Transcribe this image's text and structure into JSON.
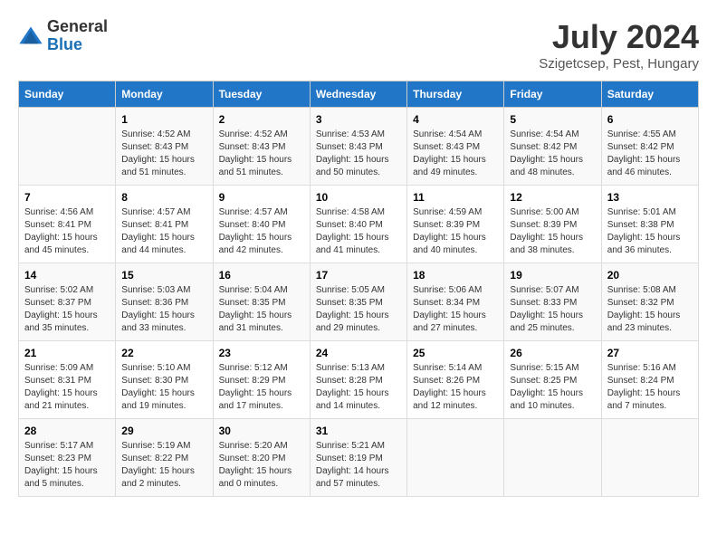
{
  "header": {
    "logo_general": "General",
    "logo_blue": "Blue",
    "month_title": "July 2024",
    "location": "Szigetcsep, Pest, Hungary"
  },
  "columns": [
    "Sunday",
    "Monday",
    "Tuesday",
    "Wednesday",
    "Thursday",
    "Friday",
    "Saturday"
  ],
  "weeks": [
    [
      {
        "day": "",
        "info": ""
      },
      {
        "day": "1",
        "info": "Sunrise: 4:52 AM\nSunset: 8:43 PM\nDaylight: 15 hours\nand 51 minutes."
      },
      {
        "day": "2",
        "info": "Sunrise: 4:52 AM\nSunset: 8:43 PM\nDaylight: 15 hours\nand 51 minutes."
      },
      {
        "day": "3",
        "info": "Sunrise: 4:53 AM\nSunset: 8:43 PM\nDaylight: 15 hours\nand 50 minutes."
      },
      {
        "day": "4",
        "info": "Sunrise: 4:54 AM\nSunset: 8:43 PM\nDaylight: 15 hours\nand 49 minutes."
      },
      {
        "day": "5",
        "info": "Sunrise: 4:54 AM\nSunset: 8:42 PM\nDaylight: 15 hours\nand 48 minutes."
      },
      {
        "day": "6",
        "info": "Sunrise: 4:55 AM\nSunset: 8:42 PM\nDaylight: 15 hours\nand 46 minutes."
      }
    ],
    [
      {
        "day": "7",
        "info": "Sunrise: 4:56 AM\nSunset: 8:41 PM\nDaylight: 15 hours\nand 45 minutes."
      },
      {
        "day": "8",
        "info": "Sunrise: 4:57 AM\nSunset: 8:41 PM\nDaylight: 15 hours\nand 44 minutes."
      },
      {
        "day": "9",
        "info": "Sunrise: 4:57 AM\nSunset: 8:40 PM\nDaylight: 15 hours\nand 42 minutes."
      },
      {
        "day": "10",
        "info": "Sunrise: 4:58 AM\nSunset: 8:40 PM\nDaylight: 15 hours\nand 41 minutes."
      },
      {
        "day": "11",
        "info": "Sunrise: 4:59 AM\nSunset: 8:39 PM\nDaylight: 15 hours\nand 40 minutes."
      },
      {
        "day": "12",
        "info": "Sunrise: 5:00 AM\nSunset: 8:39 PM\nDaylight: 15 hours\nand 38 minutes."
      },
      {
        "day": "13",
        "info": "Sunrise: 5:01 AM\nSunset: 8:38 PM\nDaylight: 15 hours\nand 36 minutes."
      }
    ],
    [
      {
        "day": "14",
        "info": "Sunrise: 5:02 AM\nSunset: 8:37 PM\nDaylight: 15 hours\nand 35 minutes."
      },
      {
        "day": "15",
        "info": "Sunrise: 5:03 AM\nSunset: 8:36 PM\nDaylight: 15 hours\nand 33 minutes."
      },
      {
        "day": "16",
        "info": "Sunrise: 5:04 AM\nSunset: 8:35 PM\nDaylight: 15 hours\nand 31 minutes."
      },
      {
        "day": "17",
        "info": "Sunrise: 5:05 AM\nSunset: 8:35 PM\nDaylight: 15 hours\nand 29 minutes."
      },
      {
        "day": "18",
        "info": "Sunrise: 5:06 AM\nSunset: 8:34 PM\nDaylight: 15 hours\nand 27 minutes."
      },
      {
        "day": "19",
        "info": "Sunrise: 5:07 AM\nSunset: 8:33 PM\nDaylight: 15 hours\nand 25 minutes."
      },
      {
        "day": "20",
        "info": "Sunrise: 5:08 AM\nSunset: 8:32 PM\nDaylight: 15 hours\nand 23 minutes."
      }
    ],
    [
      {
        "day": "21",
        "info": "Sunrise: 5:09 AM\nSunset: 8:31 PM\nDaylight: 15 hours\nand 21 minutes."
      },
      {
        "day": "22",
        "info": "Sunrise: 5:10 AM\nSunset: 8:30 PM\nDaylight: 15 hours\nand 19 minutes."
      },
      {
        "day": "23",
        "info": "Sunrise: 5:12 AM\nSunset: 8:29 PM\nDaylight: 15 hours\nand 17 minutes."
      },
      {
        "day": "24",
        "info": "Sunrise: 5:13 AM\nSunset: 8:28 PM\nDaylight: 15 hours\nand 14 minutes."
      },
      {
        "day": "25",
        "info": "Sunrise: 5:14 AM\nSunset: 8:26 PM\nDaylight: 15 hours\nand 12 minutes."
      },
      {
        "day": "26",
        "info": "Sunrise: 5:15 AM\nSunset: 8:25 PM\nDaylight: 15 hours\nand 10 minutes."
      },
      {
        "day": "27",
        "info": "Sunrise: 5:16 AM\nSunset: 8:24 PM\nDaylight: 15 hours\nand 7 minutes."
      }
    ],
    [
      {
        "day": "28",
        "info": "Sunrise: 5:17 AM\nSunset: 8:23 PM\nDaylight: 15 hours\nand 5 minutes."
      },
      {
        "day": "29",
        "info": "Sunrise: 5:19 AM\nSunset: 8:22 PM\nDaylight: 15 hours\nand 2 minutes."
      },
      {
        "day": "30",
        "info": "Sunrise: 5:20 AM\nSunset: 8:20 PM\nDaylight: 15 hours\nand 0 minutes."
      },
      {
        "day": "31",
        "info": "Sunrise: 5:21 AM\nSunset: 8:19 PM\nDaylight: 14 hours\nand 57 minutes."
      },
      {
        "day": "",
        "info": ""
      },
      {
        "day": "",
        "info": ""
      },
      {
        "day": "",
        "info": ""
      }
    ]
  ]
}
